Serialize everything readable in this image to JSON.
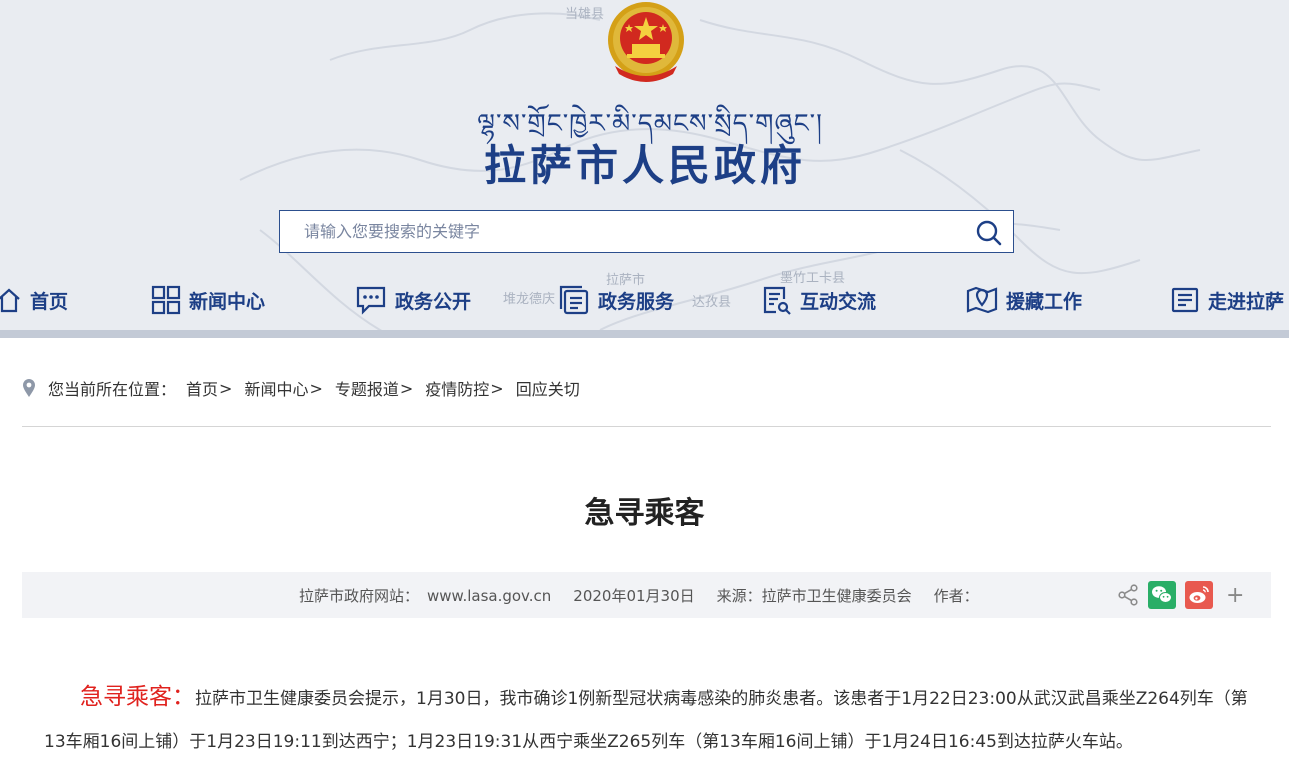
{
  "header": {
    "tibetan_name": "ལྷ་ས་གྲོང་ཁྱེར་མི་དམངས་སྲིད་གཞུང་།",
    "site_title": "拉萨市人民政府",
    "emblem_icon": "national-emblem-icon",
    "map_labels": [
      "当雄县",
      "墨竹工卡县",
      "达孜县",
      "拉萨市",
      "堆龙德庆"
    ]
  },
  "search": {
    "placeholder": "请输入您要搜索的关键字",
    "icon": "search-icon"
  },
  "nav": {
    "items": [
      {
        "label": "首页",
        "icon": "home-icon"
      },
      {
        "label": "新闻中心",
        "icon": "grid-icon"
      },
      {
        "label": "政务公开",
        "icon": "chat-bubble-icon"
      },
      {
        "label": "政务服务",
        "icon": "stacked-docs-icon"
      },
      {
        "label": "互动交流",
        "icon": "document-edit-icon"
      },
      {
        "label": "援藏工作",
        "icon": "map-pin-icon"
      },
      {
        "label": "走进拉萨",
        "icon": "newspaper-icon"
      }
    ]
  },
  "breadcrumb": {
    "prefix": "您当前所在位置：",
    "items": [
      "首页",
      "新闻中心",
      "专题报道",
      "疫情防控",
      "回应关切"
    ],
    "separator": ">"
  },
  "article": {
    "title": "急寻乘客",
    "meta": {
      "site": "拉萨市政府网站：",
      "url": "www.lasa.gov.cn",
      "date": "2020年01月30日",
      "source": "来源：拉萨市卫生健康委员会",
      "author": "作者："
    },
    "share": {
      "icons": [
        "share-icon",
        "wechat-icon",
        "weibo-icon"
      ],
      "more": "+"
    },
    "lead": "急寻乘客：",
    "body": "拉萨市卫生健康委员会提示，1月30日，我市确诊1例新型冠状病毒感染的肺炎患者。该患者于1月22日23:00从武汉武昌乘坐Z264列车（第13车厢16间上铺）于1月23日19:11到达西宁；1月23日19:31从西宁乘坐Z265列车（第13车厢16间上铺）于1月24日16:45到达拉萨火车站。"
  },
  "colors": {
    "brand_blue": "#1d3f86",
    "header_bg": "#e9ecf1",
    "nav_bar": "#c3cad6",
    "lead_red": "#e0221e",
    "wechat_green": "#2aae67",
    "weibo_red": "#e8594f"
  }
}
